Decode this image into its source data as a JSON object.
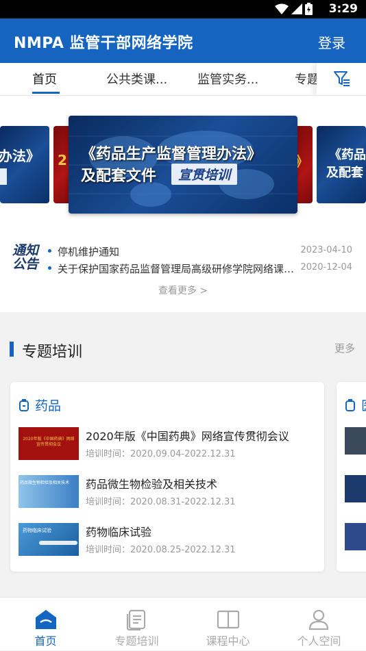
{
  "status_bar": {
    "time": "3:29"
  },
  "app_bar": {
    "title": "NMPA 监管干部网络学院",
    "login": "登录"
  },
  "tabs": [
    {
      "label": "首页",
      "active": true
    },
    {
      "label": "公共类课..."
    },
    {
      "label": "监管实务..."
    },
    {
      "label": "专题"
    }
  ],
  "banner": {
    "left_fragment": "办法》",
    "left2_fragment": "2",
    "main_line1": "《药品生产监督管理办法》",
    "main_line2": "及配套文件",
    "main_tag": "宣贯培训",
    "right_bracket": "》",
    "right_line1": "《药品",
    "right_line2": "及配套"
  },
  "notice": {
    "logo": "通知公告",
    "items": [
      {
        "title": "停机维护通知",
        "date": "2023-04-10"
      },
      {
        "title": "关于保护国家药品监督管理局高级研修学院网络课程著作权的声明",
        "date": "2020-12-04"
      }
    ],
    "see_more": "查看更多 >"
  },
  "special_training": {
    "title": "专题培训",
    "more": "更多",
    "card": {
      "title": "药品",
      "courses": [
        {
          "title": "2020年版《中国药典》网络宣传贯彻会议",
          "time": "培训时间：2020.09.04-2022.12.31",
          "thumb_text": "2020年版《中国药典》网络宣传贯彻会议"
        },
        {
          "title": "药品微生物检验及相关技术",
          "time": "培训时间：2020.08.31-2022.12.31",
          "thumb_text": "药品微生物检验及相关技术"
        },
        {
          "title": "药物临床试验",
          "time": "培训时间：2020.08.25-2022.12.31",
          "thumb_text": "药物临床试验"
        }
      ]
    },
    "next_card_title": "医"
  },
  "bottom_nav": [
    {
      "label": "首页",
      "icon": "home-icon",
      "active": true
    },
    {
      "label": "专题培训",
      "icon": "document-icon"
    },
    {
      "label": "课程中心",
      "icon": "book-icon"
    },
    {
      "label": "个人空间",
      "icon": "person-icon"
    }
  ],
  "colors": {
    "primary": "#1565c0",
    "banner_red": "#b01515"
  }
}
